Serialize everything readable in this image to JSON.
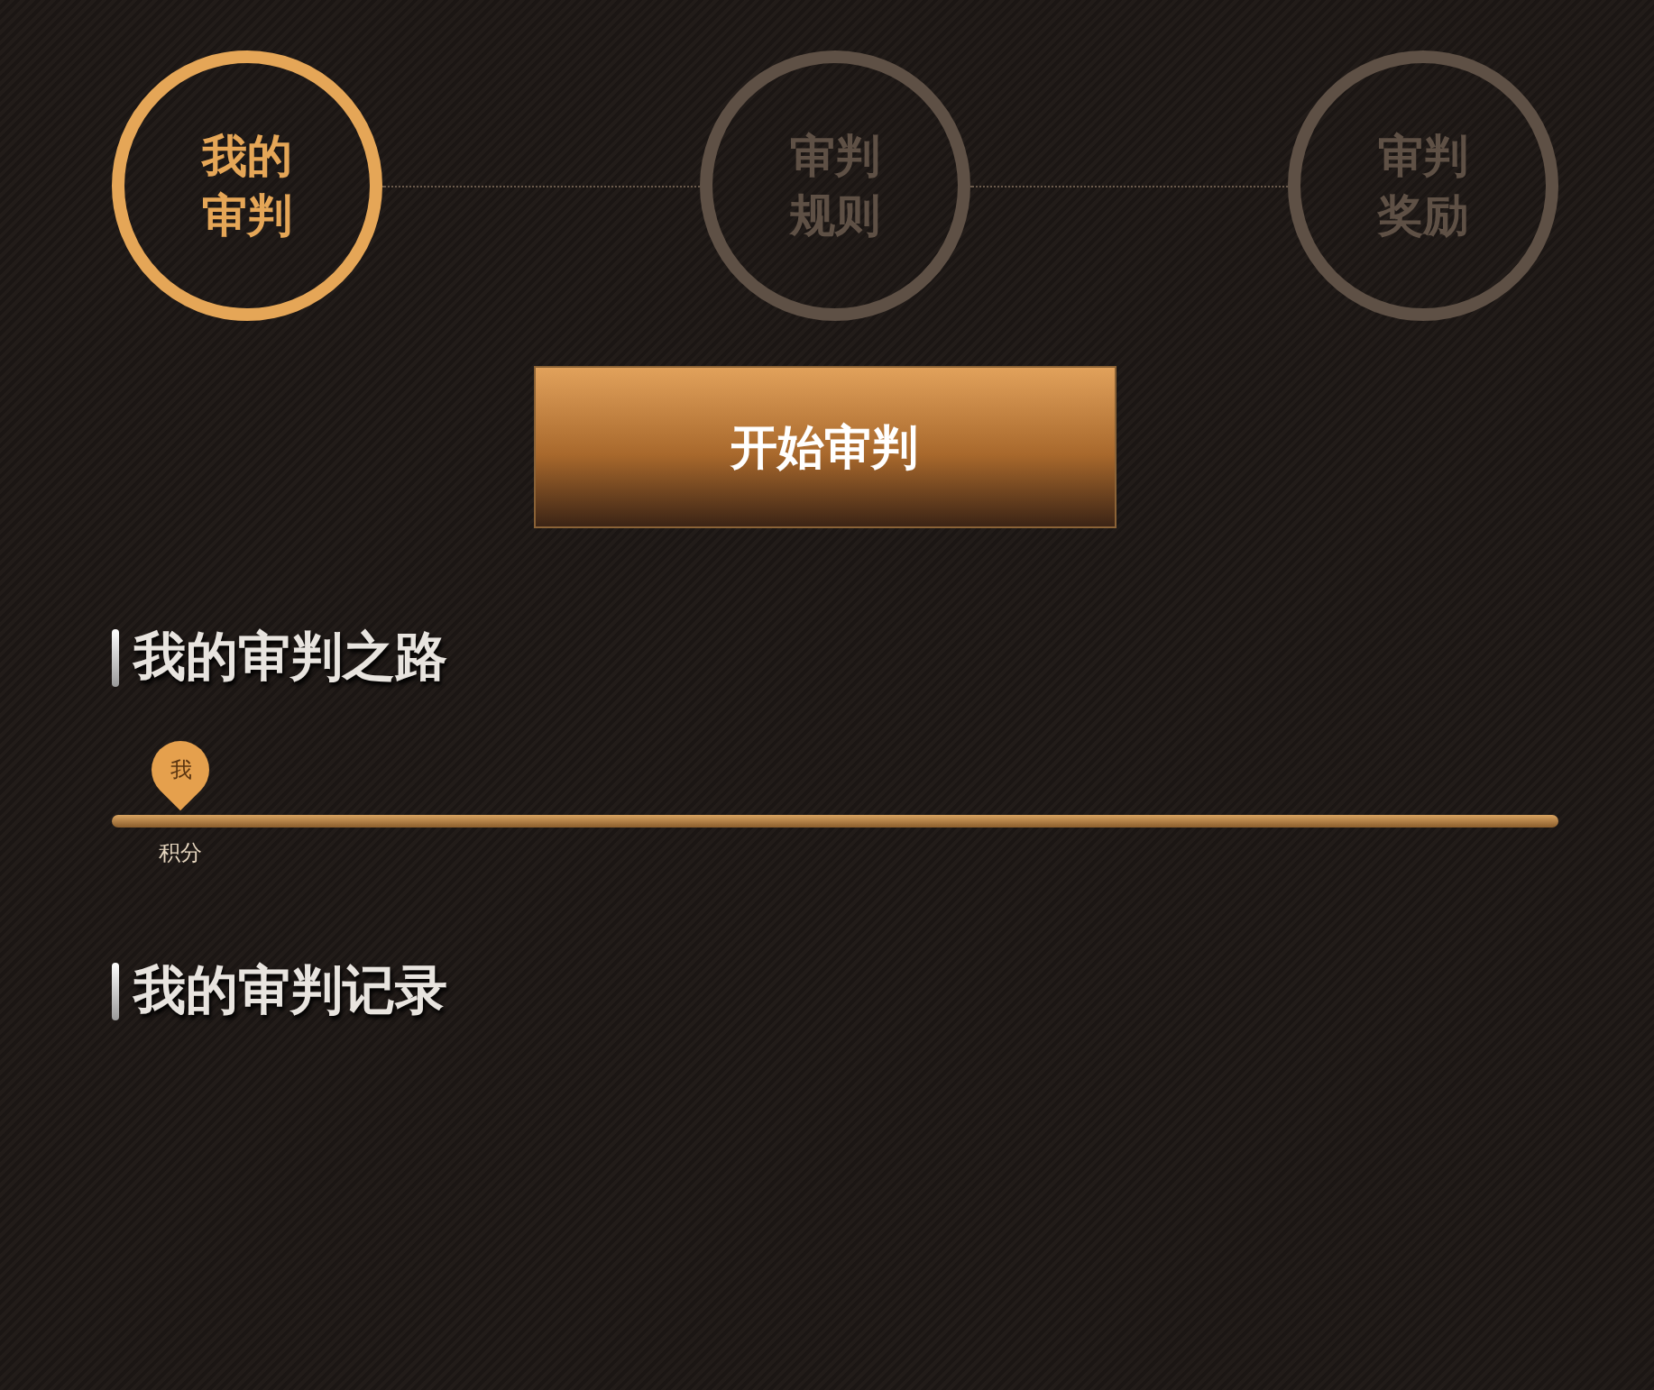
{
  "steps": [
    {
      "label": "我的审判",
      "selected": true
    },
    {
      "label": "审判规则",
      "selected": false
    },
    {
      "label": "审判奖励",
      "selected": false
    }
  ],
  "start_button": "开始审判",
  "road": {
    "title": "我的审判之路",
    "marker": "我",
    "axis_label": "积分"
  },
  "records": {
    "title": "我的审判记录"
  }
}
